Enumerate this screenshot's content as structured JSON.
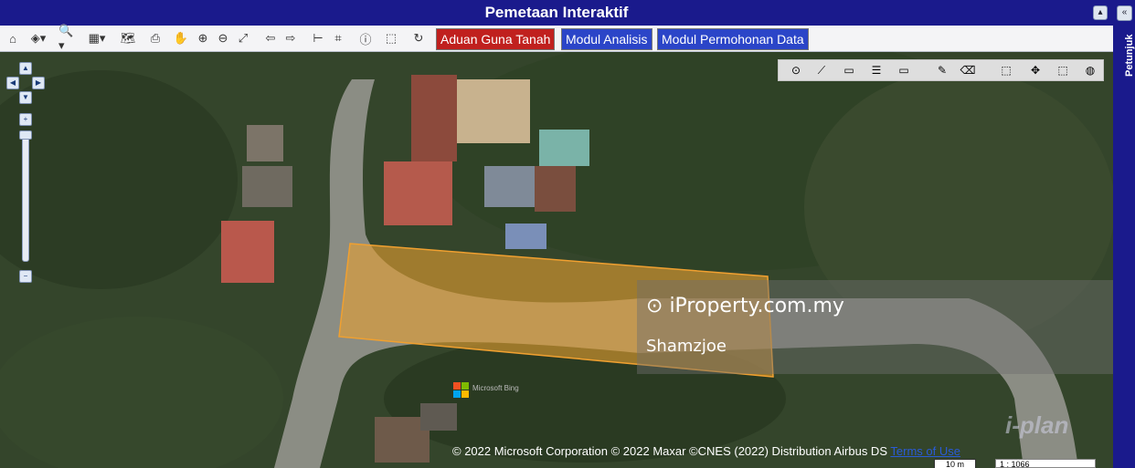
{
  "title": "Pemetaan Interaktif",
  "side_panel": {
    "label": "Petunjuk",
    "expand_icon": "«"
  },
  "titlebar": {
    "collapse_icon": "▴"
  },
  "toolbar": {
    "buttons": [
      {
        "name": "home-icon",
        "glyph": "⌂"
      },
      {
        "name": "layers-icon",
        "glyph": "◈▾"
      },
      {
        "name": "zoom-icon",
        "glyph": "🔍▾"
      },
      {
        "name": "grid-icon",
        "glyph": "▦▾"
      },
      {
        "name": "map-icon",
        "glyph": "🗺"
      },
      {
        "name": "print-icon",
        "glyph": "⎙"
      },
      {
        "name": "pan-hand-icon",
        "glyph": "✋"
      },
      {
        "name": "zoom-in-icon",
        "glyph": "⊕"
      },
      {
        "name": "zoom-out-icon",
        "glyph": "⊖"
      },
      {
        "name": "full-extent-icon",
        "glyph": "⤢"
      },
      {
        "name": "back-arrow-icon",
        "glyph": "⇦"
      },
      {
        "name": "forward-arrow-icon",
        "glyph": "⇨"
      },
      {
        "name": "measure-icon",
        "glyph": "⊢"
      },
      {
        "name": "crop-icon",
        "glyph": "⌗"
      },
      {
        "name": "info-icon",
        "glyph": "ⓘ"
      },
      {
        "name": "identify-icon",
        "glyph": "⬚"
      },
      {
        "name": "refresh-icon",
        "glyph": "↻"
      }
    ],
    "aduan_label": "Aduan Guna Tanah",
    "analisis_label": "Modul Analisis",
    "permohonan_label": "Modul Permohonan Data",
    "aduan_color": "#c0201e",
    "module_color": "#2b45c8"
  },
  "navigation": {
    "up": "▲",
    "down": "▼",
    "left": "◀",
    "right": "▶",
    "zoom_in": "+",
    "zoom_out": "−"
  },
  "edit_tools": [
    {
      "name": "add-point-icon",
      "glyph": "⊙"
    },
    {
      "name": "add-line-icon",
      "glyph": "⟋"
    },
    {
      "name": "add-polygon-icon",
      "glyph": "▭"
    },
    {
      "name": "attribute-table-icon",
      "glyph": "☰"
    },
    {
      "name": "add-rectangle-icon",
      "glyph": "▭"
    },
    {
      "name": "pencil-icon",
      "glyph": "✎"
    },
    {
      "name": "eraser-icon",
      "glyph": "⌫"
    },
    {
      "name": "select-icon",
      "glyph": "⬚"
    },
    {
      "name": "move-icon",
      "glyph": "✥"
    },
    {
      "name": "delete-icon",
      "glyph": "⬚"
    },
    {
      "name": "globe-icon",
      "glyph": "◍"
    }
  ],
  "map": {
    "parcel_color": "#e8a030",
    "watermark_site": "iProperty.com.my",
    "watermark_user": "Shamzjoe",
    "bing_logo": "Microsoft Bing",
    "iplan_logo": "i-plan",
    "copyright": "© 2022 Microsoft Corporation © 2022 Maxar ©CNES (2022) Distribution Airbus DS",
    "terms": "Terms of Use",
    "scale_label": "10 m",
    "scale_value": "1 : 1066"
  }
}
